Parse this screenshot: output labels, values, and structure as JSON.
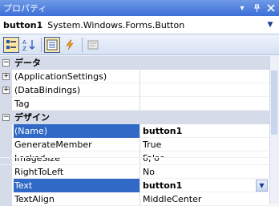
{
  "window": {
    "title": "プロパティ"
  },
  "object_selector": {
    "name": "button1",
    "type": "System.Windows.Forms.Button"
  },
  "grid": {
    "cat_data": "データ",
    "application_settings": "(ApplicationSettings)",
    "data_bindings": "(DataBindings)",
    "tag": "Tag",
    "cat_design": "デザイン",
    "name_label": "(Name)",
    "name_value": "button1",
    "generate_member": "GenerateMember",
    "generate_member_value": "True",
    "locked_label": "Locked",
    "locked_value": "False",
    "image_size_label": "ImageSize",
    "image_size_value": "0, 0",
    "right_to_left": "RightToLeft",
    "right_to_left_value": "No",
    "text_label": "Text",
    "text_value": "button1",
    "text_align": "TextAlign",
    "text_align_value": "MiddleCenter"
  }
}
